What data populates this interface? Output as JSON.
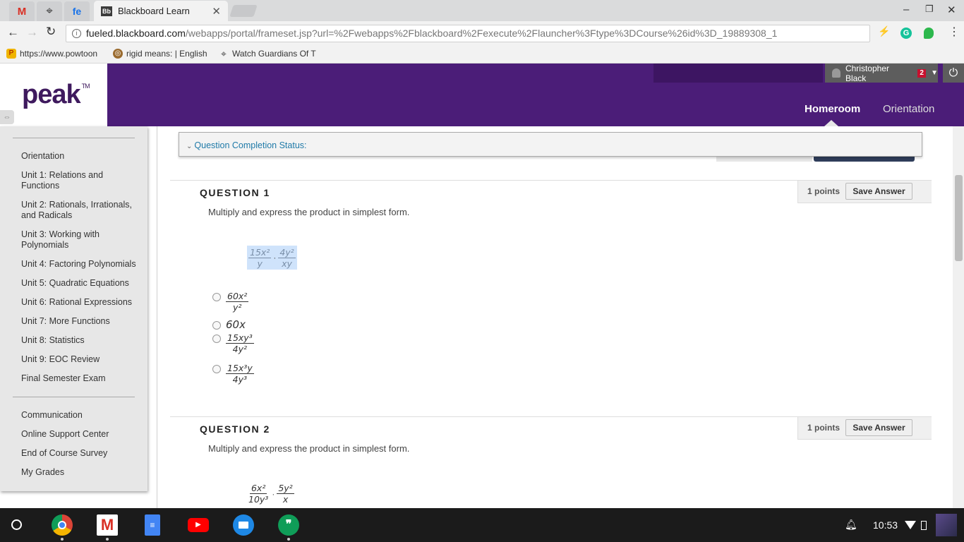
{
  "browser": {
    "active_tab_title": "Blackboard Learn",
    "active_tab_favicon": "Bb",
    "pinned_tabs": [
      {
        "icon": "gmail-icon",
        "glyph": "M",
        "color": "#d93025"
      },
      {
        "icon": "crosshair-icon",
        "glyph": "⌖",
        "color": "#444444"
      },
      {
        "icon": "fe-icon",
        "glyph": "fe",
        "color": "#1a73e8"
      }
    ],
    "url_host": "fueled.blackboard.com",
    "url_path": "/webapps/portal/frameset.jsp?url=%2Fwebapps%2Fblackboard%2Fexecute%2Flauncher%3Ftype%3DCourse%26id%3D_19889308_1",
    "bookmarks": [
      {
        "label": "https://www.powtoon",
        "icon": "powtoon-icon",
        "color": "#f0b400"
      },
      {
        "label": "rigid means: | English",
        "icon": "dictionary-icon",
        "color": "#9a6b2f"
      },
      {
        "label": "Watch Guardians Of T",
        "icon": "crosshair-icon",
        "color": "#444444"
      }
    ]
  },
  "site": {
    "logo": "peak",
    "logo_tm": "TM",
    "user_name": "Christopher Black",
    "notification_count": "2",
    "nav": {
      "homeroom": "Homeroom",
      "orientation": "Orientation"
    }
  },
  "sidebar": {
    "units": [
      "Orientation",
      "Unit 1: Relations and Functions",
      "Unit 2: Rationals, Irrationals, and Radicals",
      "Unit 3: Working with Polynomials",
      "Unit 4: Factoring Polynomials",
      "Unit 5: Quadratic Equations",
      "Unit 6: Rational Expressions",
      "Unit 7: More Functions",
      "Unit 8: Statistics",
      "Unit 9: EOC Review",
      "Final Semester Exam"
    ],
    "links": [
      "Communication",
      "Online Support Center",
      "End of Course Survey",
      "My Grades"
    ]
  },
  "main": {
    "completion_status": "Question Completion Status:",
    "questions": [
      {
        "title": "QUESTION 1",
        "points": "1 points",
        "save_label": "Save Answer",
        "prompt": "Multiply and express the product in simplest form.",
        "expression": {
          "left_num": "15x²",
          "left_den": "y",
          "right_num": "4y²",
          "right_den": "xy"
        },
        "options": [
          {
            "num": "60x²",
            "den": "y²"
          },
          {
            "plain": "60x"
          },
          {
            "num": "15xy³",
            "den": "4y²"
          },
          {
            "num": "15x³y",
            "den": "4y³"
          }
        ]
      },
      {
        "title": "QUESTION 2",
        "points": "1 points",
        "save_label": "Save Answer",
        "prompt": "Multiply and express the product in simplest form.",
        "expression": {
          "left_num": "6x²",
          "left_den": "10y³",
          "right_num": "5y²",
          "right_den": "x"
        }
      }
    ]
  },
  "taskbar": {
    "time": "10:53",
    "apps": [
      "launcher-icon",
      "chrome-icon",
      "gmail-icon",
      "docs-icon",
      "youtube-icon",
      "files-icon",
      "hangouts-icon"
    ]
  }
}
